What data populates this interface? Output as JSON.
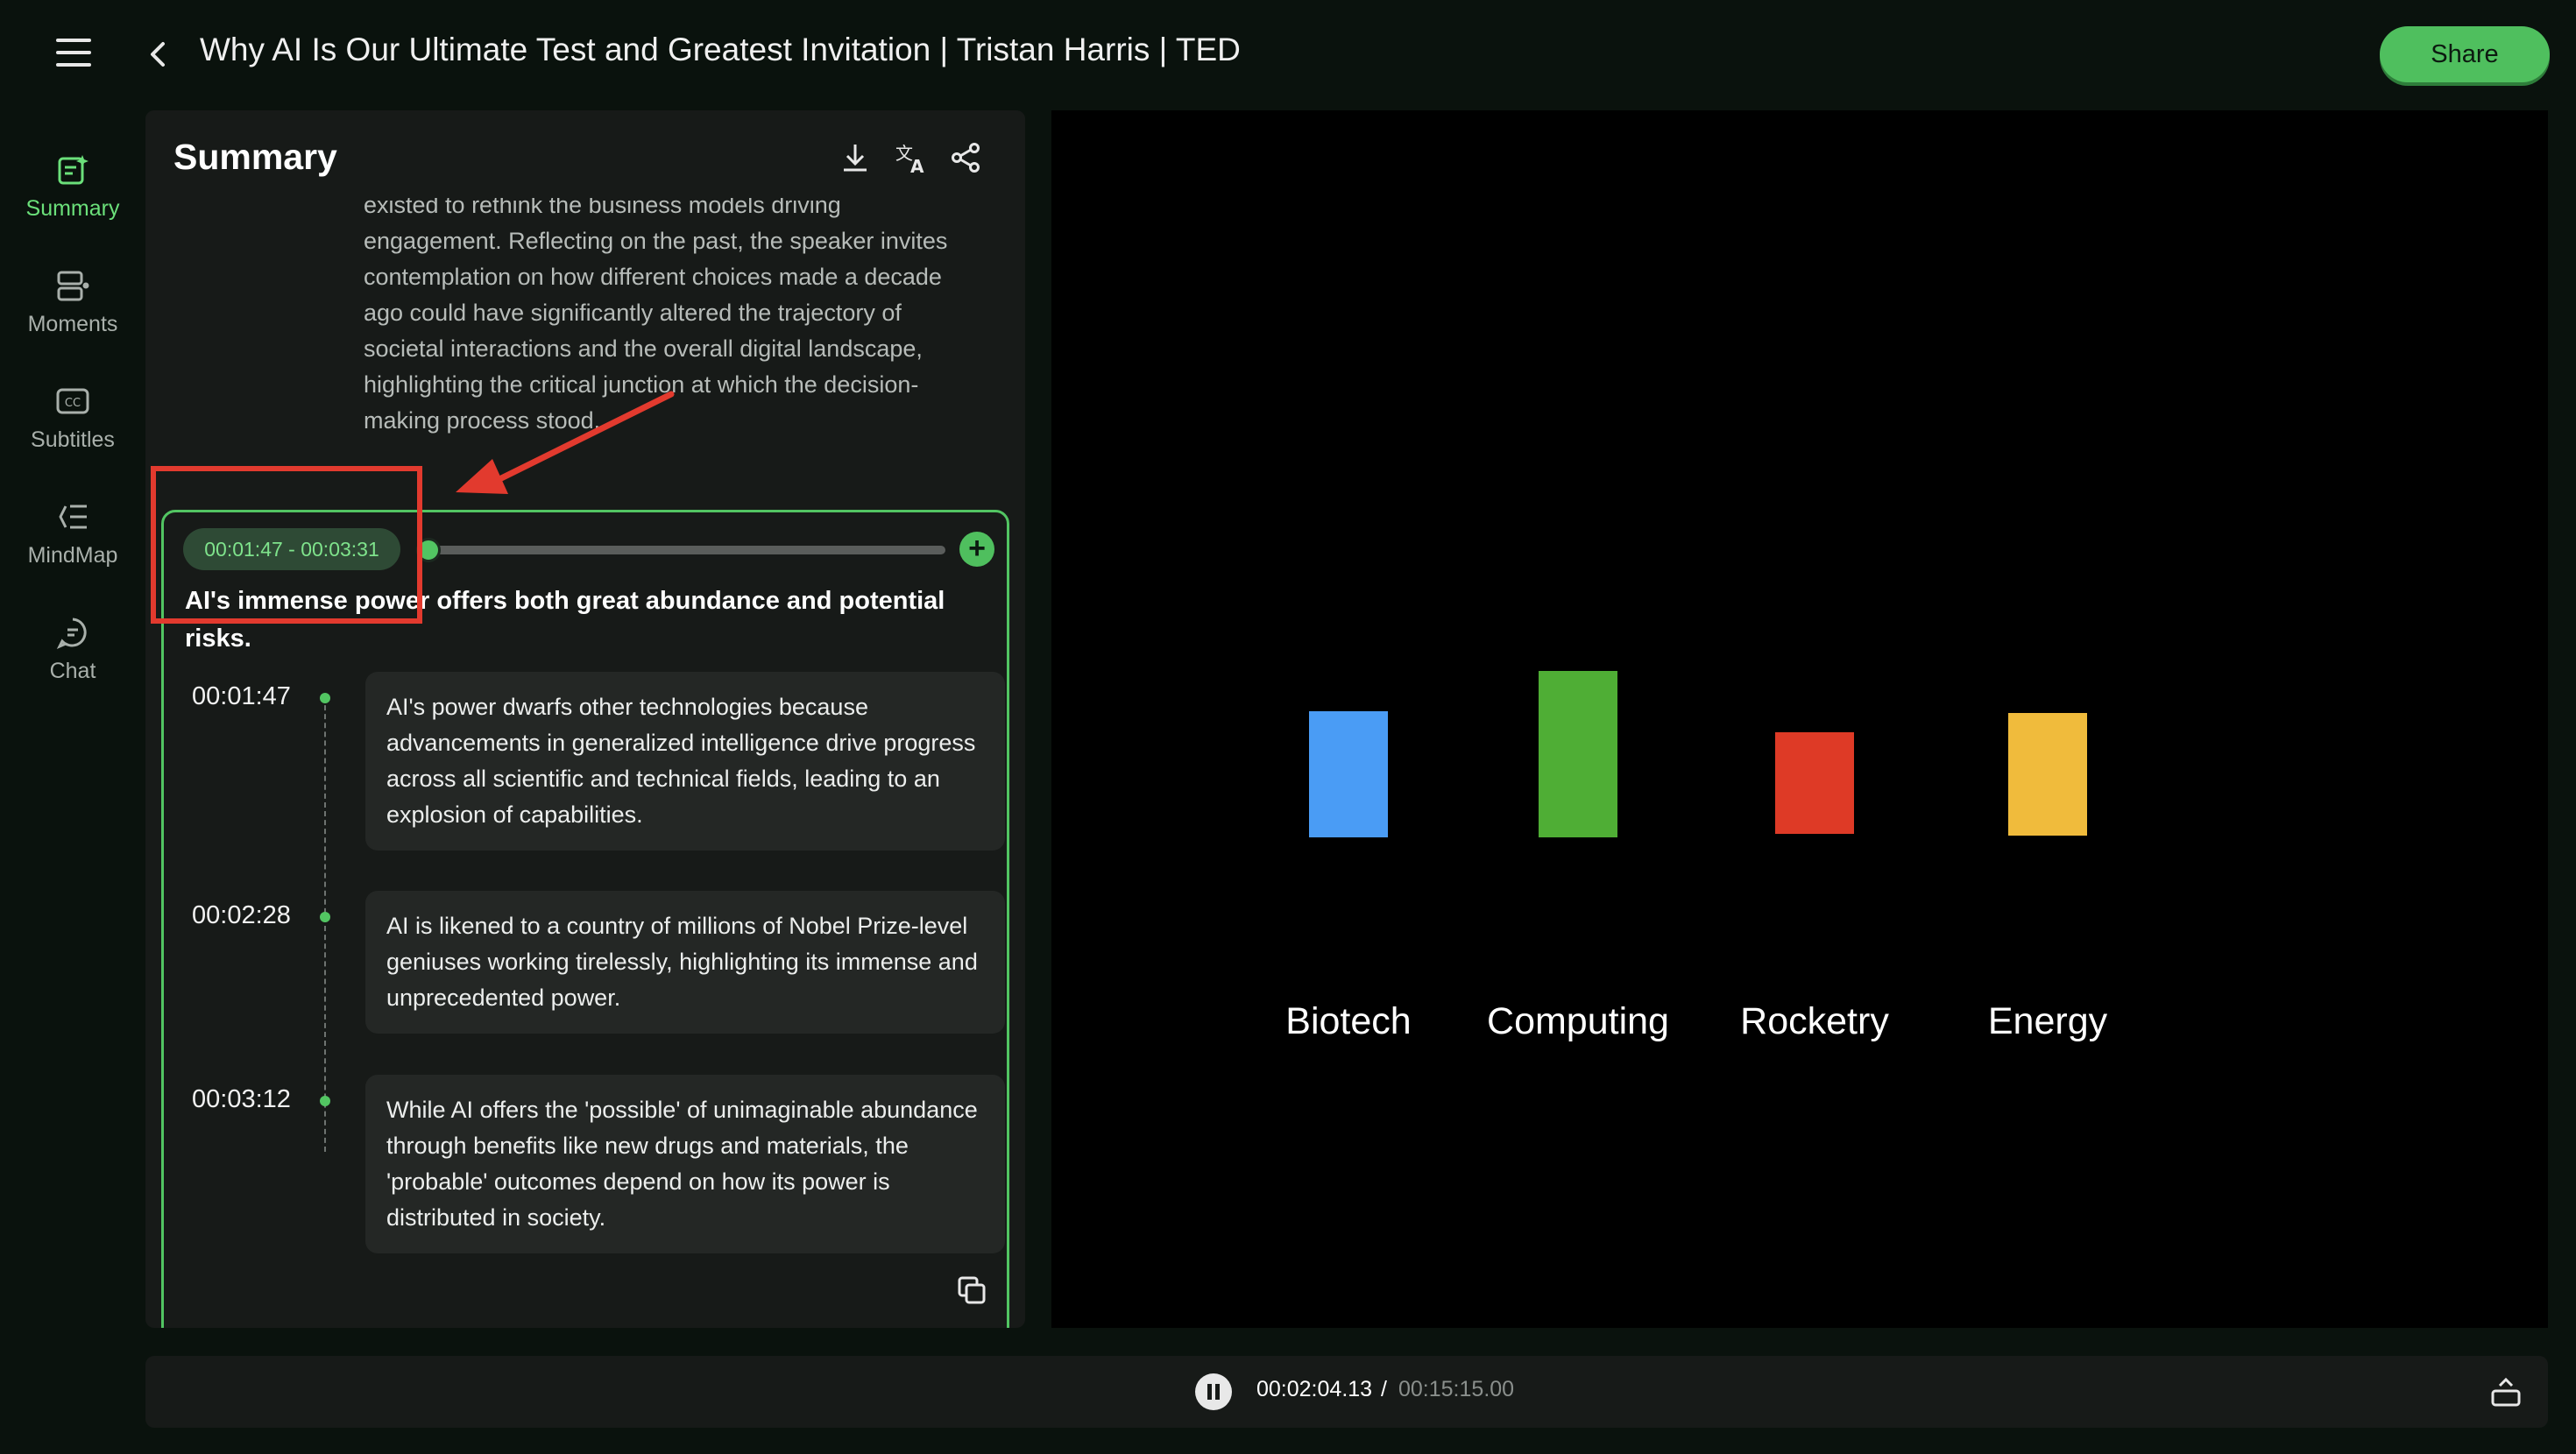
{
  "header": {
    "title": "Why AI Is Our Ultimate Test and Greatest Invitation | Tristan Harris | TED",
    "share_label": "Share"
  },
  "sidebar": {
    "items": [
      {
        "label": "Summary",
        "icon": "summary-icon",
        "active": true
      },
      {
        "label": "Moments",
        "icon": "moments-icon",
        "active": false
      },
      {
        "label": "Subtitles",
        "icon": "subtitles-icon",
        "active": false
      },
      {
        "label": "MindMap",
        "icon": "mindmap-icon",
        "active": false
      },
      {
        "label": "Chat",
        "icon": "chat-icon",
        "active": false
      }
    ]
  },
  "summary": {
    "title": "Summary",
    "icons": [
      "download-icon",
      "translate-icon",
      "share-icon"
    ],
    "intro_lines": [
      "existed to rethink the business models driving",
      "engagement. Reflecting on the past, the speaker invites",
      "contemplation on how different choices made a decade",
      "ago could have significantly altered the trajectory of",
      "societal interactions and the overall digital landscape,",
      "highlighting the critical junction at which the decision-",
      "making process stood."
    ],
    "chapter": {
      "time_range": "00:01:47 - 00:03:31",
      "progress": 0.02,
      "title": "AI's immense power offers both great abundance and potential risks.",
      "moments": [
        {
          "time": "00:01:47",
          "text": "AI's power dwarfs other technologies because advancements in generalized intelligence drive progress across all scientific and technical fields, leading to an explosion of capabilities."
        },
        {
          "time": "00:02:28",
          "text": "AI is likened to a country of millions of Nobel Prize-level geniuses working tirelessly, highlighting its immense and unprecedented power."
        },
        {
          "time": "00:03:12",
          "text": "While AI offers the 'possible' of unimaginable abundance through benefits like new drugs and materials, the 'probable' outcomes depend on how its power is distributed in society."
        }
      ]
    }
  },
  "video": {
    "bars": [
      {
        "label": "Biotech",
        "color": "#4a9cf5"
      },
      {
        "label": "Computing",
        "color": "#4fae35"
      },
      {
        "label": "Rocketry",
        "color": "#de3a26"
      },
      {
        "label": "Energy",
        "color": "#f0bb3c"
      }
    ]
  },
  "player": {
    "current_time": "00:02:04.13",
    "separator": "/",
    "total_time": "00:15:15.00"
  },
  "colors": {
    "accent": "#52c562",
    "annotation": "#e23a2e",
    "panel": "#171a18"
  }
}
